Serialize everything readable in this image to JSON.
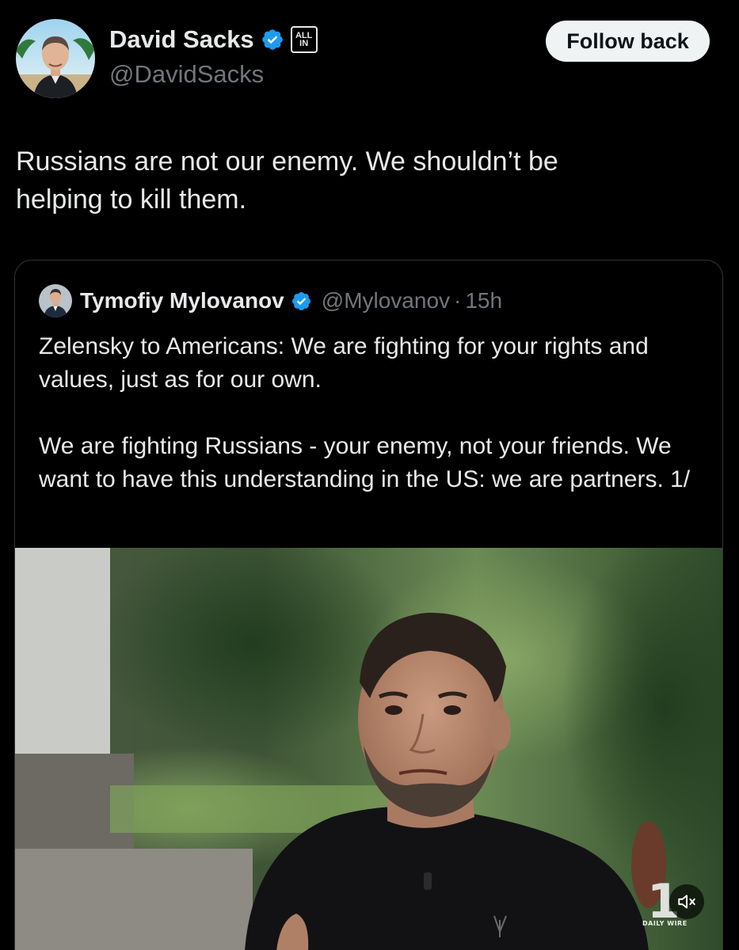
{
  "author": {
    "display_name": "David Sacks",
    "handle": "@DavidSacks",
    "affiliation_badge": "ALL IN",
    "verified": true
  },
  "follow_button": {
    "label": "Follow back"
  },
  "tweet": {
    "lines": [
      "Russians are not our enemy. We shouldn’t be",
      "helping to kill them."
    ]
  },
  "quoted_tweet": {
    "display_name": "Tymofiy Mylovanov",
    "handle": "@Mylovanov",
    "separator": "·",
    "time": "15h",
    "verified": true,
    "paragraphs": [
      "Zelensky to Americans: We are fighting for your rights and values, just as for our own.",
      "We are fighting Russians - your enemy, not your friends. We want to have this understanding in the US: we are partners. 1/"
    ],
    "media": {
      "type": "video",
      "watermark": "DAILY WIRE",
      "muted": true
    }
  },
  "colors": {
    "background": "#000000",
    "text": "#e7e9ea",
    "secondary_text": "#71767b",
    "verified_blue": "#1d9bf0",
    "button_bg": "#eff3f4",
    "border": "#2f3336"
  },
  "icons": [
    "verified-badge-icon",
    "all-in-affiliation-icon",
    "mute-icon"
  ]
}
